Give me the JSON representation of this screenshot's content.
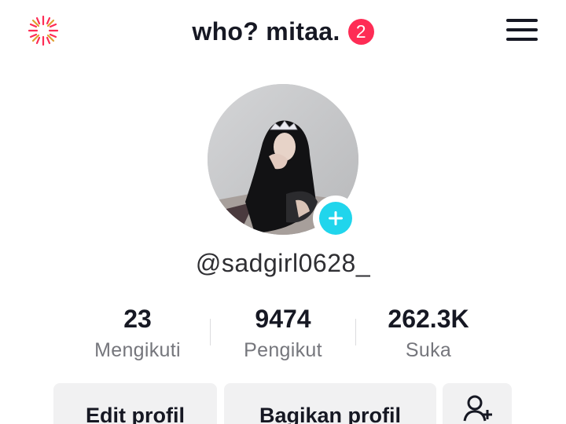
{
  "header": {
    "title": "who? mitaa.",
    "notification_count": "2",
    "left_icon": "sparkle-icon",
    "menu_icon": "hamburger-menu-icon"
  },
  "profile": {
    "username": "@sadgirl0628_",
    "avatar_alt": "profile-photo",
    "add_icon": "plus-icon"
  },
  "stats": [
    {
      "value": "23",
      "label": "Mengikuti"
    },
    {
      "value": "9474",
      "label": "Pengikut"
    },
    {
      "value": "262.3K",
      "label": "Suka"
    }
  ],
  "actions": {
    "edit_profile": "Edit profil",
    "share_profile": "Bagikan profil",
    "add_friend_icon": "add-friend-icon"
  },
  "colors": {
    "badge": "#fe2c55",
    "add_button": "#20d5ec",
    "button_bg": "#f1f1f2",
    "muted_text": "#75767c"
  }
}
